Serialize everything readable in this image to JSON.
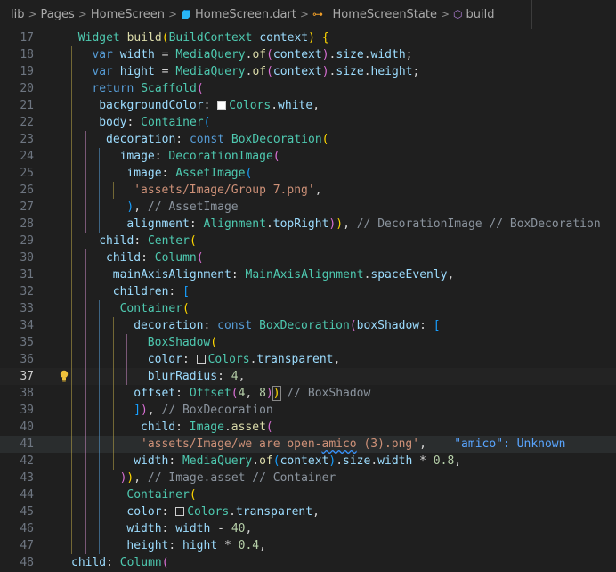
{
  "breadcrumb": {
    "items": [
      "lib",
      "Pages",
      "HomeScreen",
      "HomeScreen.dart",
      "_HomeScreenState",
      "build"
    ],
    "separator": ">"
  },
  "editor": {
    "active_line": 37,
    "highlight_line": 41,
    "lines": [
      {
        "num": 17,
        "tokens": [
          [
            "ty",
            "Widget "
          ],
          [
            "fn",
            "build"
          ],
          [
            "b1",
            "("
          ],
          [
            "ty",
            "BuildContext "
          ],
          [
            "vr",
            "context"
          ],
          [
            "b1",
            ")"
          ],
          [
            "pn",
            " "
          ],
          [
            "b1",
            "{"
          ]
        ]
      },
      {
        "num": 18,
        "tokens": [
          [
            "kw",
            "var "
          ],
          [
            "vr",
            "width"
          ],
          [
            "pn",
            " = "
          ],
          [
            "ty",
            "MediaQuery"
          ],
          [
            "pn",
            "."
          ],
          [
            "fn",
            "of"
          ],
          [
            "b2",
            "("
          ],
          [
            "vr",
            "context"
          ],
          [
            "b2",
            ")"
          ],
          [
            "pn",
            "."
          ],
          [
            "vr",
            "size"
          ],
          [
            "pn",
            "."
          ],
          [
            "vr",
            "width"
          ],
          [
            "pn",
            ";"
          ]
        ]
      },
      {
        "num": 19,
        "tokens": [
          [
            "kw",
            "var "
          ],
          [
            "vr",
            "hight"
          ],
          [
            "pn",
            " = "
          ],
          [
            "ty",
            "MediaQuery"
          ],
          [
            "pn",
            "."
          ],
          [
            "fn",
            "of"
          ],
          [
            "b2",
            "("
          ],
          [
            "vr",
            "context"
          ],
          [
            "b2",
            ")"
          ],
          [
            "pn",
            "."
          ],
          [
            "vr",
            "size"
          ],
          [
            "pn",
            "."
          ],
          [
            "vr",
            "height"
          ],
          [
            "pn",
            ";"
          ]
        ]
      },
      {
        "num": 20,
        "tokens": [
          [
            "kw",
            "return "
          ],
          [
            "ty",
            "Scaffold"
          ],
          [
            "b2",
            "("
          ]
        ]
      },
      {
        "num": 21,
        "tokens": [
          [
            "vr",
            "backgroundColor"
          ],
          [
            "pn",
            ": "
          ],
          [
            "swatch",
            "white"
          ],
          [
            "ty",
            "Colors"
          ],
          [
            "pn",
            "."
          ],
          [
            "vr",
            "white"
          ],
          [
            "pn",
            ","
          ]
        ]
      },
      {
        "num": 22,
        "tokens": [
          [
            "vr",
            "body"
          ],
          [
            "pn",
            ": "
          ],
          [
            "ty",
            "Container"
          ],
          [
            "b3",
            "("
          ]
        ]
      },
      {
        "num": 23,
        "tokens": [
          [
            "vr",
            "decoration"
          ],
          [
            "pn",
            ": "
          ],
          [
            "kw",
            "const "
          ],
          [
            "ty",
            "BoxDecoration"
          ],
          [
            "b1",
            "("
          ]
        ]
      },
      {
        "num": 24,
        "tokens": [
          [
            "vr",
            "image"
          ],
          [
            "pn",
            ": "
          ],
          [
            "ty",
            "DecorationImage"
          ],
          [
            "b2",
            "("
          ]
        ]
      },
      {
        "num": 25,
        "tokens": [
          [
            "vr",
            "image"
          ],
          [
            "pn",
            ": "
          ],
          [
            "ty",
            "AssetImage"
          ],
          [
            "b3",
            "("
          ]
        ]
      },
      {
        "num": 26,
        "tokens": [
          [
            "st",
            "'assets/Image/Group 7.png'"
          ],
          [
            "pn",
            ","
          ]
        ]
      },
      {
        "num": 27,
        "tokens": [
          [
            "b3",
            ")"
          ],
          [
            "pn",
            ", "
          ],
          [
            "cm",
            "// AssetImage"
          ]
        ]
      },
      {
        "num": 28,
        "tokens": [
          [
            "vr",
            "alignment"
          ],
          [
            "pn",
            ": "
          ],
          [
            "ty",
            "Alignment"
          ],
          [
            "pn",
            "."
          ],
          [
            "vr",
            "topRight"
          ],
          [
            "b2",
            ")"
          ],
          [
            "b1",
            ")"
          ],
          [
            "pn",
            ", "
          ],
          [
            "cm",
            "// DecorationImage // BoxDecoration"
          ]
        ]
      },
      {
        "num": 29,
        "tokens": [
          [
            "vr",
            "child"
          ],
          [
            "pn",
            ": "
          ],
          [
            "ty",
            "Center"
          ],
          [
            "b1",
            "("
          ]
        ]
      },
      {
        "num": 30,
        "tokens": [
          [
            "vr",
            "child"
          ],
          [
            "pn",
            ": "
          ],
          [
            "ty",
            "Column"
          ],
          [
            "b2",
            "("
          ]
        ]
      },
      {
        "num": 31,
        "tokens": [
          [
            "vr",
            "mainAxisAlignment"
          ],
          [
            "pn",
            ": "
          ],
          [
            "ty",
            "MainAxisAlignment"
          ],
          [
            "pn",
            "."
          ],
          [
            "vr",
            "spaceEvenly"
          ],
          [
            "pn",
            ","
          ]
        ]
      },
      {
        "num": 32,
        "tokens": [
          [
            "vr",
            "children"
          ],
          [
            "pn",
            ": "
          ],
          [
            "b3",
            "["
          ]
        ]
      },
      {
        "num": 33,
        "tokens": [
          [
            "ty",
            "Container"
          ],
          [
            "b1",
            "("
          ]
        ]
      },
      {
        "num": 34,
        "tokens": [
          [
            "vr",
            "decoration"
          ],
          [
            "pn",
            ": "
          ],
          [
            "kw",
            "const "
          ],
          [
            "ty",
            "BoxDecoration"
          ],
          [
            "b2",
            "("
          ],
          [
            "vr",
            "boxShadow"
          ],
          [
            "pn",
            ": "
          ],
          [
            "b3",
            "["
          ]
        ]
      },
      {
        "num": 35,
        "tokens": [
          [
            "ty",
            "BoxShadow"
          ],
          [
            "b1",
            "("
          ]
        ]
      },
      {
        "num": 36,
        "tokens": [
          [
            "vr",
            "color"
          ],
          [
            "pn",
            ": "
          ],
          [
            "swatch",
            "transparent"
          ],
          [
            "ty",
            "Colors"
          ],
          [
            "pn",
            "."
          ],
          [
            "vr",
            "transparent"
          ],
          [
            "pn",
            ","
          ]
        ]
      },
      {
        "num": 37,
        "tokens": [
          [
            "vr",
            "blurRadius"
          ],
          [
            "pn",
            ": "
          ],
          [
            "nm",
            "4"
          ],
          [
            "pn",
            ","
          ]
        ]
      },
      {
        "num": 38,
        "tokens": [
          [
            "vr",
            "offset"
          ],
          [
            "pn",
            ": "
          ],
          [
            "ty",
            "Offset"
          ],
          [
            "b2",
            "("
          ],
          [
            "nm",
            "4"
          ],
          [
            "pn",
            ", "
          ],
          [
            "nm",
            "8"
          ],
          [
            "b2",
            ")"
          ],
          [
            "brk",
            ")"
          ],
          [
            "pn",
            " "
          ],
          [
            "cm",
            "// BoxShadow"
          ]
        ]
      },
      {
        "num": 39,
        "tokens": [
          [
            "b3",
            "]"
          ],
          [
            "b2",
            ")"
          ],
          [
            "pn",
            ", "
          ],
          [
            "cm",
            "// BoxDecoration"
          ]
        ]
      },
      {
        "num": 40,
        "tokens": [
          [
            "vr",
            "child"
          ],
          [
            "pn",
            ": "
          ],
          [
            "ty",
            "Image"
          ],
          [
            "pn",
            "."
          ],
          [
            "fn",
            "asset"
          ],
          [
            "b2",
            "("
          ]
        ]
      },
      {
        "num": 41,
        "tokens": [
          [
            "st",
            "'assets/Image/we are open-"
          ],
          [
            "squig",
            "amico"
          ],
          [
            "st",
            " (3).png'"
          ],
          [
            "pn",
            ",    "
          ],
          [
            "hint",
            "\"amico\": Unknown"
          ]
        ]
      },
      {
        "num": 42,
        "tokens": [
          [
            "vr",
            "width"
          ],
          [
            "pn",
            ": "
          ],
          [
            "ty",
            "MediaQuery"
          ],
          [
            "pn",
            "."
          ],
          [
            "fn",
            "of"
          ],
          [
            "b3",
            "("
          ],
          [
            "vr",
            "context"
          ],
          [
            "b3",
            ")"
          ],
          [
            "pn",
            "."
          ],
          [
            "vr",
            "size"
          ],
          [
            "pn",
            "."
          ],
          [
            "vr",
            "width"
          ],
          [
            "pn",
            " * "
          ],
          [
            "nm",
            "0.8"
          ],
          [
            "pn",
            ","
          ]
        ]
      },
      {
        "num": 43,
        "tokens": [
          [
            "b2",
            ")"
          ],
          [
            "b1",
            ")"
          ],
          [
            "pn",
            ", "
          ],
          [
            "cm",
            "// Image.asset // Container"
          ]
        ]
      },
      {
        "num": 44,
        "tokens": [
          [
            "ty",
            "Container"
          ],
          [
            "b1",
            "("
          ]
        ]
      },
      {
        "num": 45,
        "tokens": [
          [
            "vr",
            "color"
          ],
          [
            "pn",
            ": "
          ],
          [
            "swatch",
            "transparent"
          ],
          [
            "ty",
            "Colors"
          ],
          [
            "pn",
            "."
          ],
          [
            "vr",
            "transparent"
          ],
          [
            "pn",
            ","
          ]
        ]
      },
      {
        "num": 46,
        "tokens": [
          [
            "vr",
            "width"
          ],
          [
            "pn",
            ": "
          ],
          [
            "vr",
            "width"
          ],
          [
            "pn",
            " - "
          ],
          [
            "nm",
            "40"
          ],
          [
            "pn",
            ","
          ]
        ]
      },
      {
        "num": 47,
        "tokens": [
          [
            "vr",
            "height"
          ],
          [
            "pn",
            ": "
          ],
          [
            "vr",
            "hight"
          ],
          [
            "pn",
            " * "
          ],
          [
            "nm",
            "0.4"
          ],
          [
            "pn",
            ","
          ]
        ]
      },
      {
        "num": 48,
        "tokens": [
          [
            "vr",
            "child"
          ],
          [
            "pn",
            ": "
          ],
          [
            "ty",
            "Column"
          ],
          [
            "b2",
            "("
          ]
        ]
      }
    ]
  }
}
